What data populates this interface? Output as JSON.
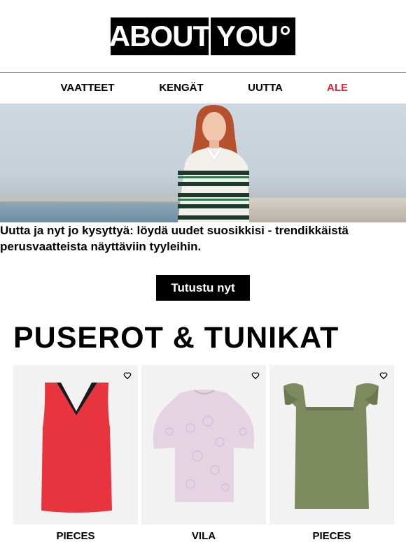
{
  "logo": {
    "left": "ABOUT",
    "right": "YOU"
  },
  "nav": {
    "items": [
      {
        "label": "VAATTEET"
      },
      {
        "label": "KENGÄT"
      },
      {
        "label": "UUTTA"
      },
      {
        "label": "ALE"
      }
    ],
    "sale_color": "#e2233b"
  },
  "hero": {
    "text": "Uutta ja nyt jo kysyttyä: löydä uudet suosikkisi - trendikkäistä perusvaatteista näyttäviin tyyleihin.",
    "cta_label": "Tutustu nyt"
  },
  "section": {
    "title": "PUSEROT & TUNIKAT"
  },
  "products": [
    {
      "brand": "PIECES",
      "color": "#e8343f",
      "icon": "heart-icon"
    },
    {
      "brand": "VILA",
      "color": "#e6d3e2",
      "icon": "heart-icon"
    },
    {
      "brand": "PIECES",
      "color": "#7d8a5e",
      "icon": "heart-icon"
    }
  ]
}
